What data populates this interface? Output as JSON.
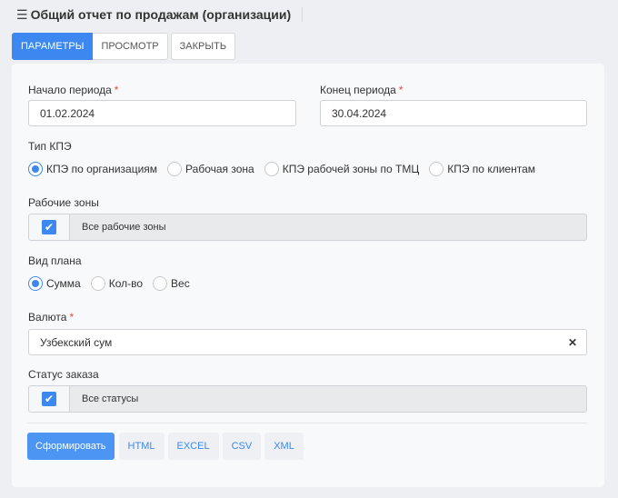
{
  "header": {
    "menu_icon": "hamburger-icon",
    "title": "Общий отчет по продажам (организации)"
  },
  "tabs": [
    {
      "label": "ПАРАМЕТРЫ",
      "active": true
    },
    {
      "label": "ПРОСМОТР",
      "active": false
    },
    {
      "label": "ЗАКРЫТЬ",
      "active": false
    }
  ],
  "form": {
    "required_mark": "*",
    "period_start": {
      "label": "Начало периода",
      "value": "01.02.2024"
    },
    "period_end": {
      "label": "Конец периода",
      "value": "30.04.2024"
    },
    "kpe_type": {
      "label": "Тип КПЭ",
      "options": [
        "КПЭ по организациям",
        "Рабочая зона",
        "КПЭ рабочей зоны по ТМЦ",
        "КПЭ по клиентам"
      ],
      "selected": "КПЭ по организациям"
    },
    "work_zones": {
      "label": "Рабочие зоны",
      "checked": true,
      "text": "Все рабочие зоны"
    },
    "plan_type": {
      "label": "Вид плана",
      "options": [
        "Сумма",
        "Кол-во",
        "Вес"
      ],
      "selected": "Сумма"
    },
    "currency": {
      "label": "Валюта",
      "value": "Узбекский сум",
      "clear_glyph": "✕"
    },
    "order_status": {
      "label": "Статус заказа",
      "checked": true,
      "text": "Все статусы"
    }
  },
  "actions": {
    "generate": "Сформировать",
    "exports": [
      "HTML",
      "EXCEL",
      "CSV",
      "XML"
    ]
  },
  "colors": {
    "accent": "#3c88f0",
    "required": "#e34b3c",
    "background": "#eeeff2",
    "panel": "#f8f9fa"
  }
}
